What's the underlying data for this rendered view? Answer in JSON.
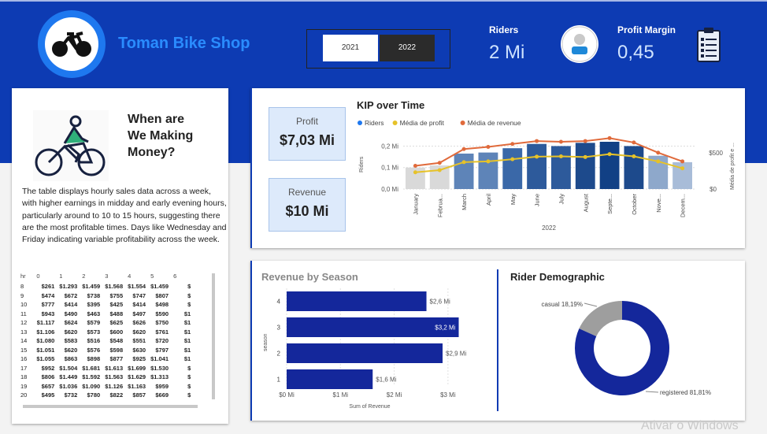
{
  "header": {
    "shop_name": "Toman Bike Shop",
    "years": [
      "2021",
      "2022"
    ],
    "selected_year": "2022",
    "riders_label": "Riders",
    "riders_value": "2 Mi",
    "profit_margin_label": "Profit Margin",
    "profit_margin_value": "0,45",
    "colors": {
      "header_bg": "#0d3bb3",
      "accent": "#2a8cff"
    }
  },
  "when_card": {
    "title_lines": [
      "When are",
      "We Making",
      "Money?"
    ],
    "description": "The table displays hourly sales data across a week, with higher earnings in midday and early evening hours, particularly around  to 10 to 15 hours, suggesting there are the most profitable times. Days like Wednesday and Friday indicating variable profitability across the week.",
    "matrix": {
      "columns": [
        "hr",
        "0",
        "1",
        "2",
        "3",
        "4",
        "5",
        "6"
      ],
      "rows": [
        [
          "8",
          "$261",
          "$1.293",
          "$1.459",
          "$1.568",
          "$1.554",
          "$1.459",
          "$"
        ],
        [
          "9",
          "$474",
          "$672",
          "$738",
          "$755",
          "$747",
          "$807",
          "$"
        ],
        [
          "10",
          "$777",
          "$414",
          "$395",
          "$425",
          "$414",
          "$498",
          "$"
        ],
        [
          "11",
          "$943",
          "$490",
          "$463",
          "$488",
          "$497",
          "$590",
          "$1"
        ],
        [
          "12",
          "$1.117",
          "$624",
          "$579",
          "$625",
          "$626",
          "$750",
          "$1"
        ],
        [
          "13",
          "$1.106",
          "$620",
          "$573",
          "$600",
          "$620",
          "$761",
          "$1"
        ],
        [
          "14",
          "$1.080",
          "$583",
          "$516",
          "$548",
          "$551",
          "$720",
          "$1"
        ],
        [
          "15",
          "$1.051",
          "$620",
          "$576",
          "$598",
          "$630",
          "$797",
          "$1"
        ],
        [
          "16",
          "$1.055",
          "$863",
          "$898",
          "$877",
          "$925",
          "$1.041",
          "$1"
        ],
        [
          "17",
          "$952",
          "$1.504",
          "$1.681",
          "$1.613",
          "$1.699",
          "$1.530",
          "$"
        ],
        [
          "18",
          "$806",
          "$1.449",
          "$1.592",
          "$1.563",
          "$1.629",
          "$1.313",
          "$"
        ],
        [
          "19",
          "$657",
          "$1.036",
          "$1.090",
          "$1.126",
          "$1.163",
          "$959",
          "$"
        ],
        [
          "20",
          "$495",
          "$732",
          "$780",
          "$822",
          "$857",
          "$669",
          "$"
        ]
      ]
    }
  },
  "kpis": {
    "profit_label": "Profit",
    "profit_value": "$7,03 Mi",
    "revenue_label": "Revenue",
    "revenue_value": "$10 Mi"
  },
  "chart_data": [
    {
      "type": "bar",
      "title": "KIP over Time",
      "legend": [
        "Riders",
        "Média de profit",
        "Média de revenue"
      ],
      "legend_colors": [
        "#1e78ef",
        "#e6c229",
        "#e06a3b"
      ],
      "legend_placement": "top-left",
      "categories": [
        "January",
        "Februa...",
        "March",
        "April",
        "May",
        "June",
        "July",
        "August",
        "Septe...",
        "October",
        "Nove...",
        "Decem..."
      ],
      "xlabel": "2022",
      "ylabel": "Riders",
      "y2label": "Média de profit e ...",
      "yticks": [
        "0,2 Mi",
        "0,1 Mi",
        "0,0 Mi"
      ],
      "y2ticks": [
        "$500",
        "$0"
      ],
      "ylim": [
        0,
        0.22
      ],
      "y2lim": [
        0,
        650
      ],
      "series": [
        {
          "name": "Riders",
          "values": [
            0.1,
            0.11,
            0.165,
            0.17,
            0.19,
            0.21,
            0.2,
            0.215,
            0.22,
            0.2,
            0.155,
            0.125
          ]
        },
        {
          "name": "Média de profit",
          "values": [
            230,
            260,
            370,
            380,
            410,
            445,
            450,
            440,
            480,
            450,
            380,
            285
          ]
        },
        {
          "name": "Média de revenue",
          "values": [
            320,
            360,
            550,
            580,
            620,
            660,
            650,
            660,
            700,
            640,
            500,
            380
          ]
        }
      ],
      "bar_colors": [
        "#d9d9d9",
        "#d9d9d9",
        "#5e84b8",
        "#5e84b8",
        "#3a68a8",
        "#2d5a9b",
        "#2d5a9b",
        "#1d4a8c",
        "#114085",
        "#1d4a8c",
        "#8ea8cb",
        "#a8bcd8"
      ],
      "grid": true
    },
    {
      "type": "bar",
      "orientation": "horizontal",
      "title": "Revenue by Season",
      "categories": [
        "4",
        "3",
        "2",
        "1"
      ],
      "values": [
        2.6,
        3.2,
        2.9,
        1.6
      ],
      "data_labels": [
        "$2,6 Mi",
        "$3,2 Mi",
        "$2,9 Mi",
        "$1,6 Mi"
      ],
      "xticks": [
        "$0 Mi",
        "$1 Mi",
        "$2 Mi",
        "$3 Mi"
      ],
      "xlim": [
        0,
        3.5
      ],
      "xlabel": "Sum of Revenue",
      "ylabel": "season",
      "bar_color": "#14279b",
      "grid": true
    },
    {
      "type": "pie",
      "title": "Rider Demographic",
      "labels": [
        "casual",
        "registered"
      ],
      "values": [
        18.19,
        81.81
      ],
      "data_labels": [
        "casual 18,19%",
        "registered 81,81%"
      ],
      "colors": [
        "#9e9e9e",
        "#14279b"
      ]
    }
  ],
  "watermark": "Ativar o Windows"
}
